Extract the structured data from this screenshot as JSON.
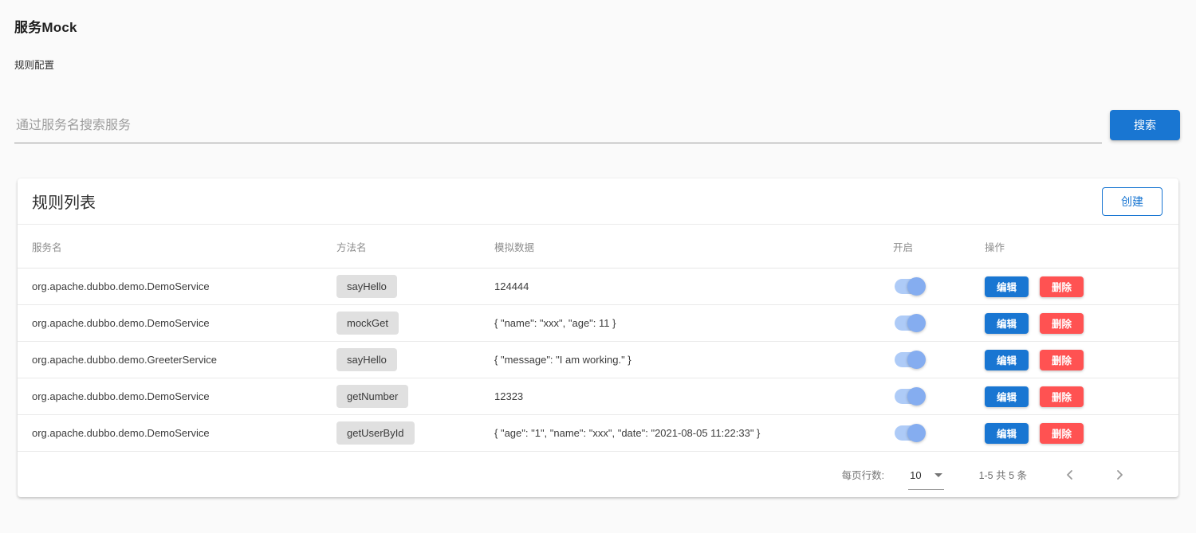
{
  "page": {
    "title": "服务Mock",
    "breadcrumb": "规则配置"
  },
  "search": {
    "placeholder": "通过服务名搜索服务",
    "button_label": "搜索"
  },
  "card": {
    "title": "规则列表",
    "create_button_label": "创建"
  },
  "table": {
    "headers": {
      "service": "服务名",
      "method": "方法名",
      "mock_data": "模拟数据",
      "enabled": "开启",
      "actions": "操作"
    },
    "row_actions": {
      "edit_label": "编辑",
      "delete_label": "删除"
    },
    "rows": [
      {
        "service": "org.apache.dubbo.demo.DemoService",
        "method": "sayHello",
        "mock_data": "124444",
        "enabled": true
      },
      {
        "service": "org.apache.dubbo.demo.DemoService",
        "method": "mockGet",
        "mock_data": "{ \"name\": \"xxx\", \"age\": 11 }",
        "enabled": true
      },
      {
        "service": "org.apache.dubbo.demo.GreeterService",
        "method": "sayHello",
        "mock_data": "{ \"message\": \"I am working.\" }",
        "enabled": true
      },
      {
        "service": "org.apache.dubbo.demo.DemoService",
        "method": "getNumber",
        "mock_data": "12323",
        "enabled": true
      },
      {
        "service": "org.apache.dubbo.demo.DemoService",
        "method": "getUserById",
        "mock_data": "{ \"age\": \"1\", \"name\": \"xxx\", \"date\": \"2021-08-05 11:22:33\" }",
        "enabled": true
      }
    ]
  },
  "pagination": {
    "rows_per_page_label": "每页行数:",
    "rows_per_page_value": "10",
    "range_text": "1-5 共 5 条"
  },
  "colors": {
    "primary": "#1976d2",
    "error": "#ff5252",
    "switch_track": "#aecbf7",
    "switch_thumb": "#85adf0",
    "chip_bg": "#e0e0e0"
  }
}
